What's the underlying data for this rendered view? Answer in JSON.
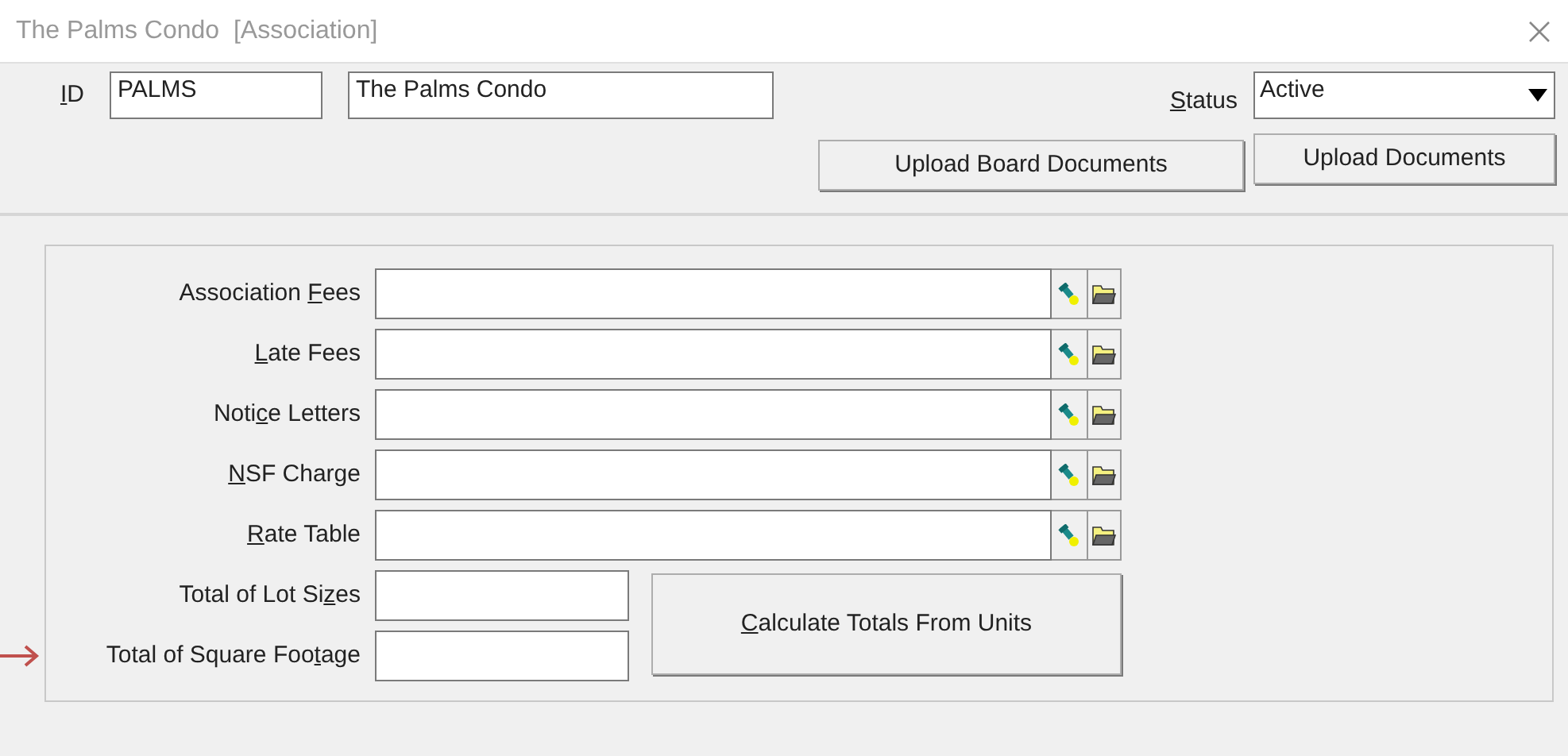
{
  "window": {
    "title": "The Palms Condo  [Association]"
  },
  "header": {
    "id_label": {
      "key": "I",
      "after": "D"
    },
    "id_value": "PALMS",
    "name_value": "The Palms Condo",
    "status_label": {
      "key": "S",
      "after": "tatus"
    },
    "status_value": "Active"
  },
  "top_buttons": [
    {
      "label": "Upload Board Documents"
    },
    {
      "label": "Upload Documents"
    }
  ],
  "lookup_fields": [
    {
      "label": {
        "before": "Association ",
        "key": "F",
        "after": "ees"
      }
    },
    {
      "label": {
        "key": "L",
        "after": "ate Fees"
      }
    },
    {
      "label": {
        "before": "Noti",
        "key": "c",
        "after": "e Letters"
      }
    },
    {
      "label": {
        "key": "N",
        "after": "SF Charge"
      }
    },
    {
      "label": {
        "key": "R",
        "after": "ate Table"
      }
    }
  ],
  "total_fields": [
    {
      "label": {
        "before": "Total of Lot Si",
        "key": "z",
        "after": "es"
      },
      "marked": false
    },
    {
      "label": {
        "before": "Total of Square Foo",
        "key": "t",
        "after": "age"
      },
      "marked": true
    }
  ],
  "calculate_button": {
    "label": {
      "key": "C",
      "after": "alculate Totals From Units"
    }
  }
}
